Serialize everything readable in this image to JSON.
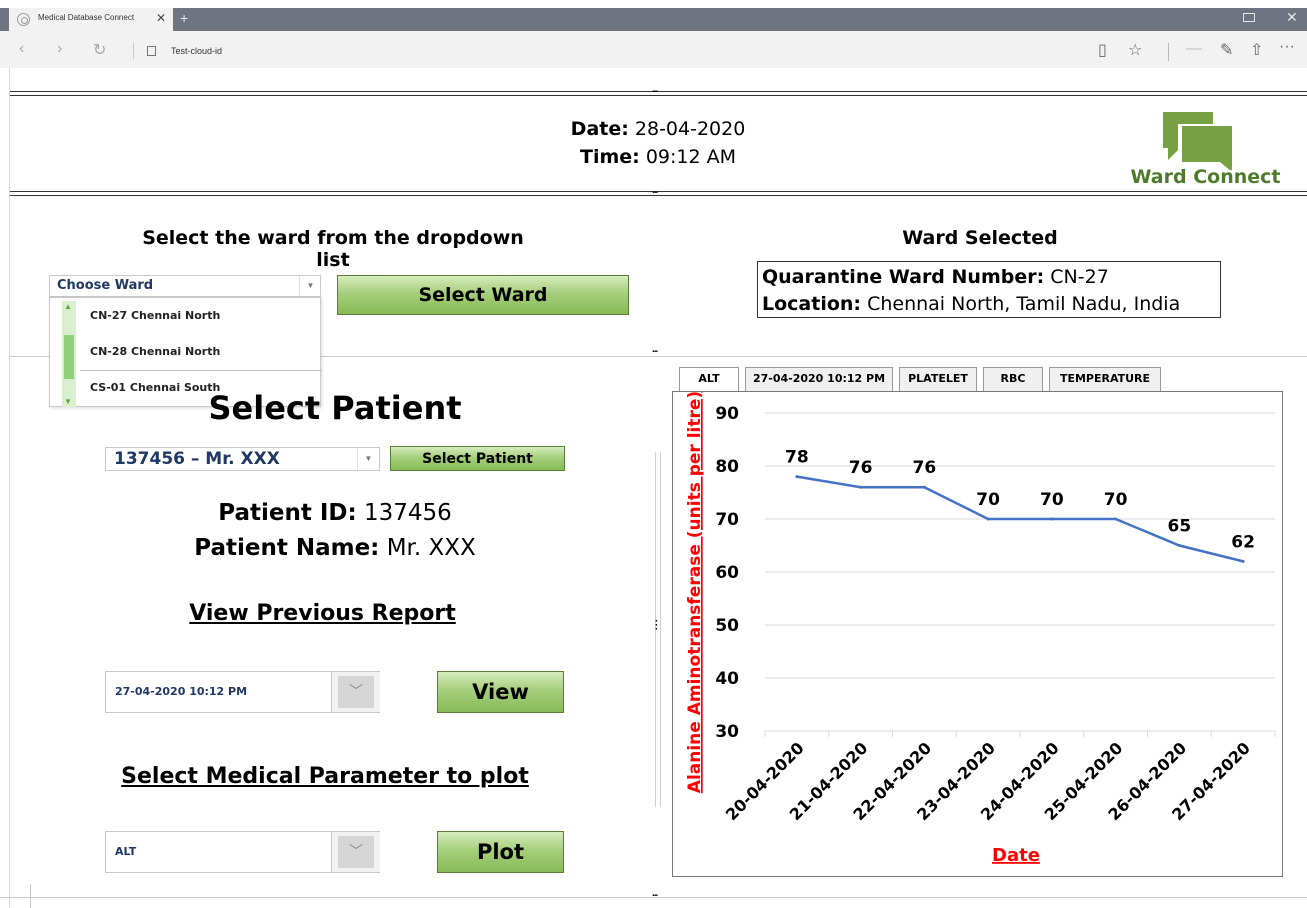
{
  "browser": {
    "tab_title": "Medical Database Connect",
    "tab_close": "✕",
    "new_tab": "+",
    "address": "Test-cloud-id",
    "nav_back": "‹",
    "nav_forward": "›",
    "nav_refresh": "↻",
    "tool_reading": "▯",
    "tool_favorite": "☆",
    "tool_minus": "—",
    "tool_notes": "✎",
    "tool_share": "⇧",
    "tool_more": "···",
    "win_close": "✕"
  },
  "header": {
    "date_label": "Date:",
    "date_value": "28-04-2020",
    "time_label": "Time:",
    "time_value": "09:12 AM",
    "logo_text": "Ward Connect",
    "logo_color": "#77a043"
  },
  "ward": {
    "heading": "Select the ward from the dropdown list",
    "select_value": "Choose Ward",
    "options": [
      "CN-27 Chennai North",
      "CN-28 Chennai North",
      "CS-01 Chennai South"
    ],
    "select_button": "Select Ward",
    "selected_heading": "Ward Selected",
    "number_label": "Quarantine Ward Number:",
    "number_value": "CN-27",
    "location_label": "Location:",
    "location_value": "Chennai North, Tamil Nadu, India"
  },
  "patient": {
    "heading": "Select Patient",
    "select_value": "137456 – Mr. XXX",
    "select_button": "Select Patient",
    "id_label": "Patient ID:",
    "id_value": "137456",
    "name_label": "Patient Name:",
    "name_value": "Mr. XXX"
  },
  "report": {
    "heading": "View Previous Report",
    "value": "27-04-2020 10:12 PM",
    "button": "View"
  },
  "param": {
    "heading": "Select Medical Parameter to plot",
    "value": "ALT",
    "button": "Plot"
  },
  "chart_tabs": [
    "ALT",
    "27-04-2020 10:12 PM",
    "PLATELET",
    "RBC",
    "TEMPERATURE"
  ],
  "separator": "...",
  "chart_data": {
    "type": "line",
    "categories": [
      "20-04-2020",
      "21-04-2020",
      "22-04-2020",
      "23-04-2020",
      "24-04-2020",
      "25-04-2020",
      "26-04-2020",
      "27-04-2020"
    ],
    "values": [
      78,
      76,
      76,
      70,
      70,
      70,
      65,
      62
    ],
    "xlabel": "Date",
    "ylabel": "Alanine Aminotransferase (units per litre)",
    "ylim": [
      30,
      90
    ],
    "yticks": [
      30,
      40,
      50,
      60,
      70,
      80,
      90
    ],
    "grid": true,
    "line_color": "#4472c4",
    "label_color": "#ff0000"
  }
}
